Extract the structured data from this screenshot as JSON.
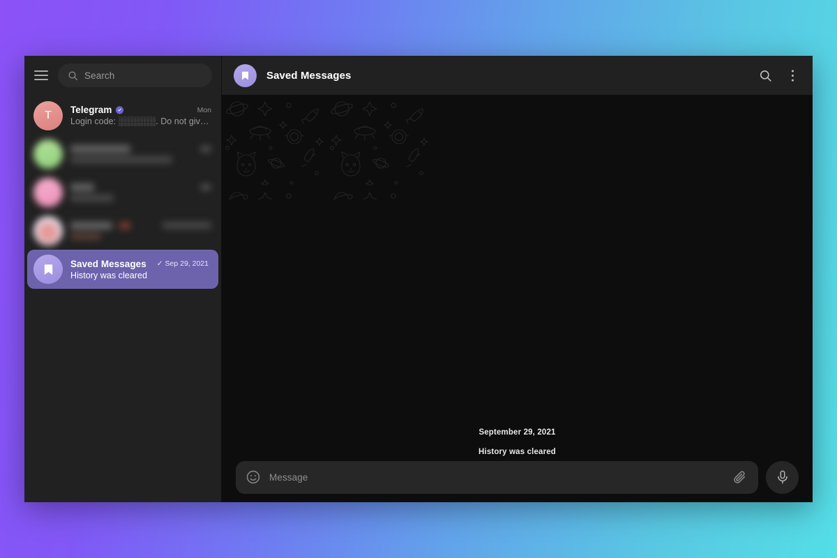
{
  "window": {
    "background_gradient_start": "#8c52f7",
    "background_gradient_end": "#54dee6",
    "app_bg": "#212121"
  },
  "sidebar": {
    "menu_button_name": "menu",
    "search": {
      "placeholder": "Search",
      "icon": "search-icon"
    },
    "chats": [
      {
        "id": "telegram",
        "title": "Telegram",
        "verified": true,
        "preview": "Login code: ░░░░░░. Do not give this c...",
        "time": "Mon",
        "avatar_letter": "T",
        "avatar_color": "#e08f8c",
        "selected": false,
        "redacted": false
      },
      {
        "id": "redacted-1",
        "title": "",
        "preview": "",
        "time": "",
        "avatar_letter": "",
        "avatar_color": "#a4d68e",
        "selected": false,
        "redacted": true
      },
      {
        "id": "redacted-2",
        "title": "",
        "preview": "",
        "time": "",
        "avatar_letter": "",
        "avatar_color": "#f0a3c4",
        "selected": false,
        "redacted": true
      },
      {
        "id": "redacted-3",
        "title": "",
        "preview": "",
        "time": "",
        "avatar_letter": "",
        "avatar_color": "#d8c9d6",
        "selected": false,
        "redacted": true
      },
      {
        "id": "saved-messages",
        "title": "Saved Messages",
        "verified": false,
        "preview": "History was cleared",
        "time": "Sep 29, 2021",
        "read_check": "✓",
        "avatar_icon": "bookmark-icon",
        "avatar_color": "#a89ce0",
        "selected": true,
        "selected_color": "#6d62ac",
        "redacted": false
      }
    ]
  },
  "chat": {
    "title": "Saved Messages",
    "avatar_icon": "bookmark-icon",
    "avatar_color": "#a89ce0",
    "actions": [
      {
        "name": "search-icon",
        "label": "Search"
      },
      {
        "name": "more-vertical-icon",
        "label": "More"
      }
    ],
    "messages": [
      {
        "type": "date-separator",
        "text": "September 29, 2021"
      },
      {
        "type": "service",
        "text": "History was cleared"
      }
    ],
    "background": {
      "name": "space-doodle-pattern",
      "color": "#0d0d0d"
    }
  },
  "composer": {
    "emoji_icon": "emoji-smile-icon",
    "placeholder": "Message",
    "value": "",
    "attach_icon": "paperclip-icon",
    "mic_icon": "microphone-icon"
  }
}
